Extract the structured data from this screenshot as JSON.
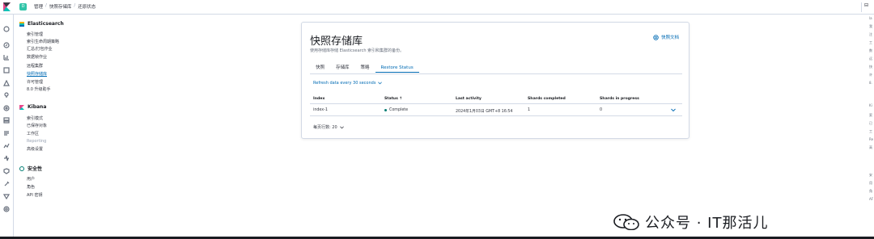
{
  "topbar": {
    "space_avatar": "D",
    "breadcrumbs": [
      "管理",
      "快照存储库",
      "还原状态"
    ],
    "right_icon": "⊟"
  },
  "iconrail": {
    "icons": [
      "recent-icon",
      "discover-icon",
      "visualize-icon",
      "dashboard-icon",
      "canvas-icon",
      "maps-icon",
      "ml-icon",
      "infrastructure-icon",
      "logs-icon",
      "apm-icon",
      "uptime-icon",
      "siem-icon",
      "devtools-icon",
      "monitoring-icon",
      "management-icon"
    ]
  },
  "sidenav": {
    "groups": [
      {
        "title": "Elasticsearch",
        "icon": "elasticsearch-icon",
        "items": [
          {
            "label": "索引管理"
          },
          {
            "label": "索引生命周期策略"
          },
          {
            "label": "汇总/打包作业"
          },
          {
            "label": "数据帧作业"
          },
          {
            "label": "远程集群"
          },
          {
            "label": "快照存储库",
            "active": true
          },
          {
            "label": "许可管理"
          },
          {
            "label": "8.0 升级助手"
          }
        ]
      },
      {
        "title": "Kibana",
        "icon": "kibana-icon",
        "items": [
          {
            "label": "索引模式"
          },
          {
            "label": "已保存对象"
          },
          {
            "label": "工作区"
          },
          {
            "label": "Reporting",
            "muted": true
          },
          {
            "label": "高级设置"
          }
        ]
      },
      {
        "title": "安全性",
        "icon": "security-icon",
        "items": [
          {
            "label": "用户"
          },
          {
            "label": "角色"
          },
          {
            "label": "API 密钥"
          }
        ]
      }
    ]
  },
  "panel": {
    "title": "快照存储库",
    "description": "使用存储库存储 Elasticsearch 索引和集群的备份。",
    "doc_link": "快照文档",
    "tabs": [
      {
        "label": "快照"
      },
      {
        "label": "存储库"
      },
      {
        "label": "策略"
      },
      {
        "label": "Restore Status",
        "active": true
      }
    ],
    "refresh": "Refresh data every 30 seconds",
    "table": {
      "headers": [
        "Index",
        "Status ↑",
        "Last activity",
        "Shards completed",
        "Shards in progress"
      ],
      "rows": [
        {
          "index": "index-1",
          "status": "Complete",
          "last_activity": "2024年1月03日 GMT+8 16:54",
          "shards_completed": "1",
          "shards_in_progress": "0"
        }
      ]
    },
    "pager": "每页行数: 20"
  },
  "right_column": {
    "glyphs": [
      "la",
      "我",
      "注",
      "工",
      "数",
      "远",
      "快",
      "许",
      "8.",
      "Ki",
      "索",
      "已",
      "工",
      "Re",
      "高",
      "安",
      "用",
      "角",
      "AF"
    ]
  },
  "watermark": {
    "text": "公众号 · IT那活儿"
  },
  "colors": {
    "accent": "#006bb4",
    "success": "#017d73",
    "space_avatar": "#31c4a8"
  }
}
